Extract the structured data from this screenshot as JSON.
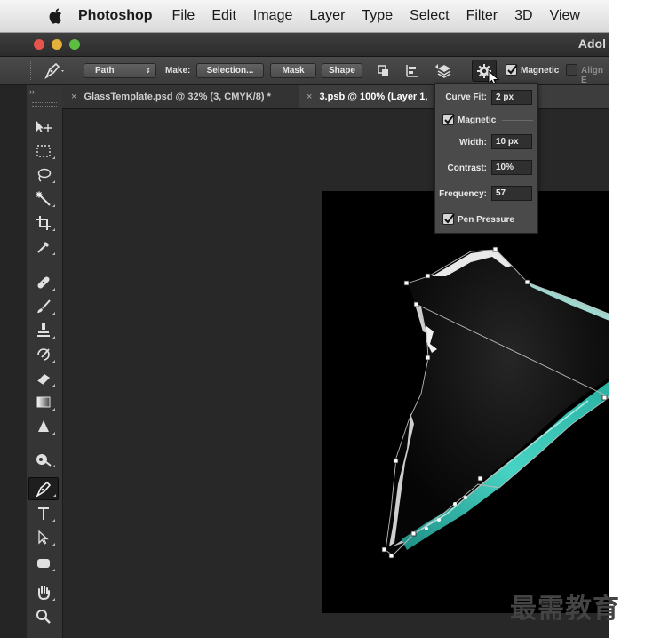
{
  "menubar": {
    "app_name": "Photoshop",
    "items": [
      "File",
      "Edit",
      "Image",
      "Layer",
      "Type",
      "Select",
      "Filter",
      "3D",
      "View"
    ]
  },
  "titlebar": {
    "title": "Adol"
  },
  "options": {
    "mode": "Path",
    "make_label": "Make:",
    "selection_button": "Selection...",
    "mask_button": "Mask",
    "shape_button": "Shape",
    "magnetic_label": "Magnetic",
    "magnetic_checked": true,
    "align_edges_label": "Align E",
    "align_edges_checked": false
  },
  "tabs": [
    {
      "label": "GlassTemplate.psd @ 32% (3, CMYK/8) *",
      "active": false
    },
    {
      "label": "3.psb @ 100% (Layer 1,",
      "active": true
    }
  ],
  "tab_close_glyph": "×",
  "pen_options_popup": {
    "curve_fit_label": "Curve Fit:",
    "curve_fit_value": "2 px",
    "magnetic_label": "Magnetic",
    "magnetic_checked": true,
    "width_label": "Width:",
    "width_value": "10 px",
    "contrast_label": "Contrast:",
    "contrast_value": "10%",
    "frequency_label": "Frequency:",
    "frequency_value": "57",
    "pen_pressure_label": "Pen Pressure",
    "pen_pressure_checked": true
  },
  "tools": [
    "move-tool-icon",
    "marquee-tool-icon",
    "lasso-tool-icon",
    "magic-wand-tool-icon",
    "crop-tool-icon",
    "eyedropper-tool-icon",
    "healing-brush-tool-icon",
    "brush-tool-icon",
    "clone-stamp-tool-icon",
    "history-brush-tool-icon",
    "eraser-tool-icon",
    "gradient-tool-icon",
    "blur-tool-icon",
    "dodge-tool-icon",
    "pen-tool-icon",
    "type-tool-icon",
    "path-selection-tool-icon",
    "shape-tool-icon",
    "hand-tool-icon",
    "zoom-tool-icon"
  ],
  "active_tool": "pen-tool-icon",
  "watermark": "最需教育",
  "colors": {
    "glass_teal": "#2fb8a8",
    "canvas_bg": "#000000",
    "ui_panel": "#353535"
  }
}
